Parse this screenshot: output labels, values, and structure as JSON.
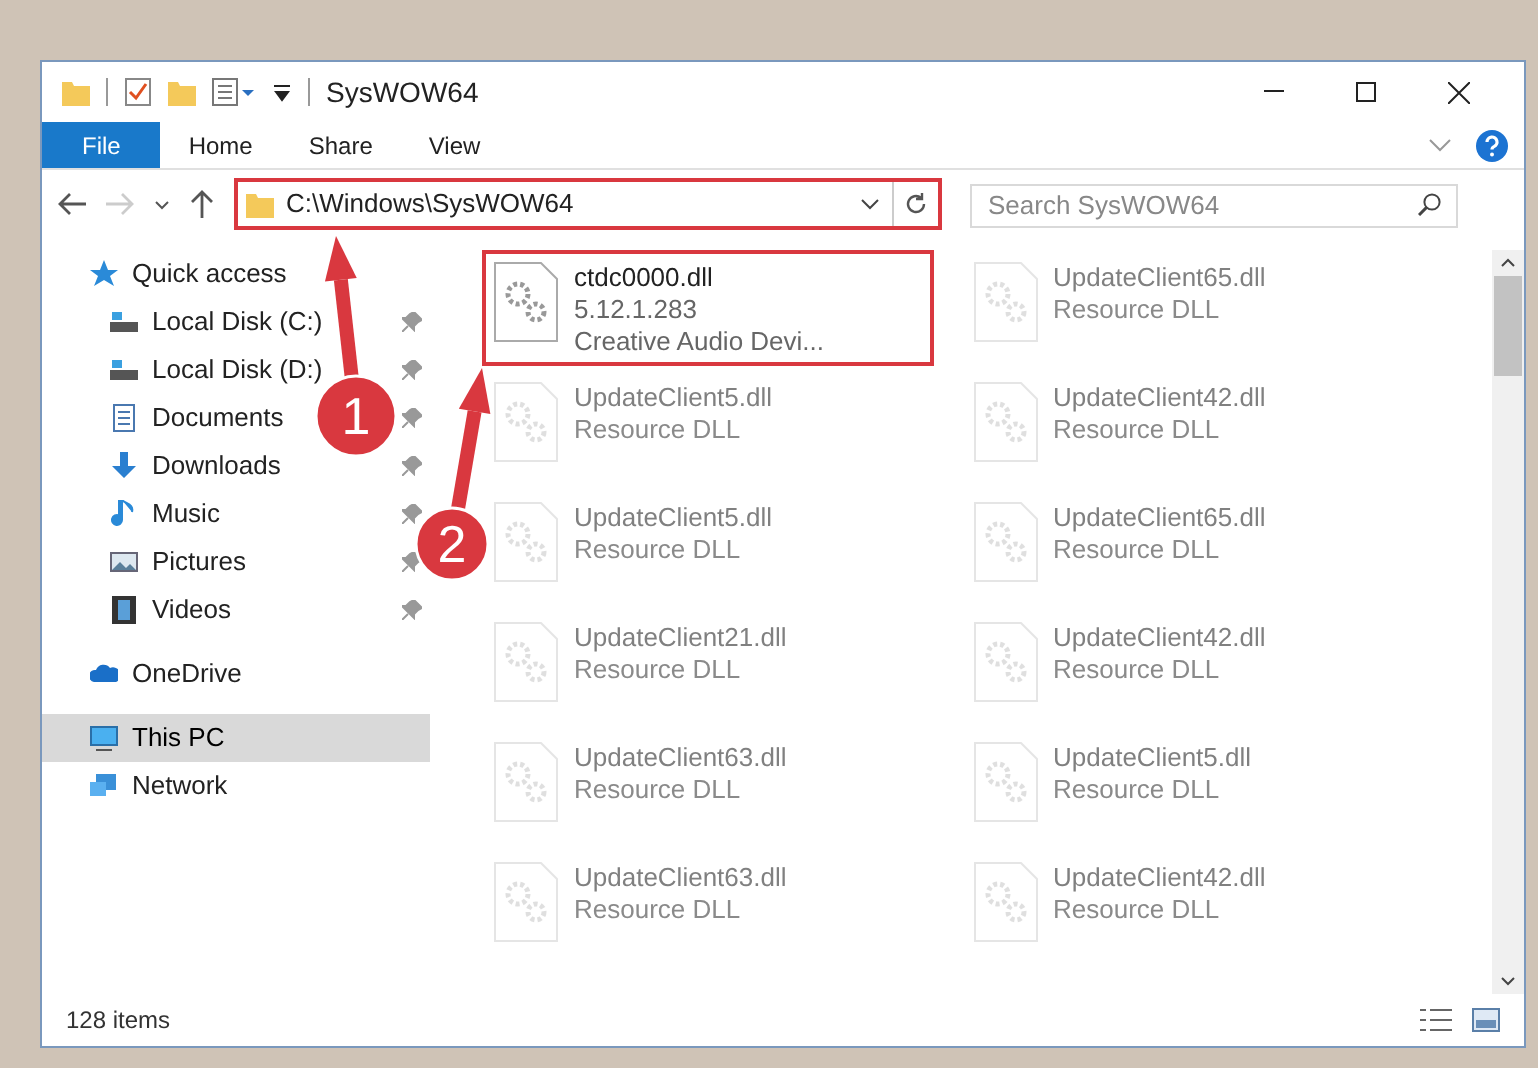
{
  "window": {
    "title": "SysWOW64"
  },
  "ribbon_tabs": [
    {
      "label": "File",
      "selected": true
    },
    {
      "label": "Home",
      "selected": false
    },
    {
      "label": "Share",
      "selected": false
    },
    {
      "label": "View",
      "selected": false
    }
  ],
  "address_bar": {
    "path": "C:\\Windows\\SysWOW64",
    "highlighted": true
  },
  "search": {
    "placeholder": "Search SysWOW64"
  },
  "sidebar": {
    "items": [
      {
        "label": "Quick access",
        "selected": false,
        "children": [
          {
            "label": "Local Disk (C:)",
            "pinned": true,
            "selected": false
          },
          {
            "label": "Local Disk (D:)",
            "pinned": true,
            "selected": false
          },
          {
            "label": "Documents",
            "pinned": true,
            "selected": false
          },
          {
            "label": "Downloads",
            "pinned": true,
            "selected": false
          },
          {
            "label": "Music",
            "pinned": true,
            "selected": false
          },
          {
            "label": "Pictures",
            "pinned": true,
            "selected": false
          },
          {
            "label": "Videos",
            "pinned": true,
            "selected": false
          }
        ]
      },
      {
        "label": "OneDrive",
        "selected": false
      },
      {
        "label": "This PC",
        "selected": true
      },
      {
        "label": "Network",
        "selected": false
      }
    ]
  },
  "files": [
    {
      "name": "ctdc0000.dll",
      "details": [
        "5.12.1.283",
        "Creative Audio Devi..."
      ],
      "highlighted": true,
      "dimmed": false
    },
    {
      "name": "UpdateClient65.dll",
      "details": [
        "Resource DLL"
      ],
      "highlighted": false,
      "dimmed": true
    },
    {
      "name": "UpdateClient5.dll",
      "details": [
        "Resource DLL"
      ],
      "highlighted": false,
      "dimmed": true
    },
    {
      "name": "UpdateClient42.dll",
      "details": [
        "Resource DLL"
      ],
      "highlighted": false,
      "dimmed": true
    },
    {
      "name": "UpdateClient5.dll",
      "details": [
        "Resource DLL"
      ],
      "highlighted": false,
      "dimmed": true
    },
    {
      "name": "UpdateClient65.dll",
      "details": [
        "Resource DLL"
      ],
      "highlighted": false,
      "dimmed": true
    },
    {
      "name": "UpdateClient21.dll",
      "details": [
        "Resource DLL"
      ],
      "highlighted": false,
      "dimmed": true
    },
    {
      "name": "UpdateClient42.dll",
      "details": [
        "Resource DLL"
      ],
      "highlighted": false,
      "dimmed": true
    },
    {
      "name": "UpdateClient63.dll",
      "details": [
        "Resource DLL"
      ],
      "highlighted": false,
      "dimmed": true
    },
    {
      "name": "UpdateClient5.dll",
      "details": [
        "Resource DLL"
      ],
      "highlighted": false,
      "dimmed": true
    },
    {
      "name": "UpdateClient63.dll",
      "details": [
        "Resource DLL"
      ],
      "highlighted": false,
      "dimmed": true
    },
    {
      "name": "UpdateClient42.dll",
      "details": [
        "Resource DLL"
      ],
      "highlighted": false,
      "dimmed": true
    }
  ],
  "status_bar": {
    "item_count": "128 items"
  },
  "annotations": [
    {
      "number": "1"
    },
    {
      "number": "2"
    }
  ]
}
